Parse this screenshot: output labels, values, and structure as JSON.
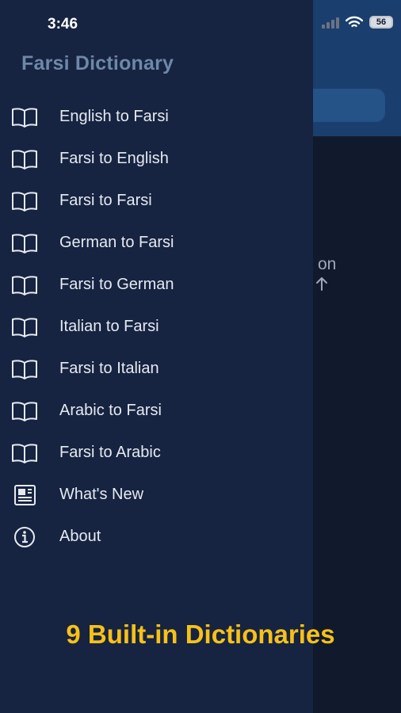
{
  "status_bar": {
    "time": "3:46",
    "battery": "56"
  },
  "background": {
    "hint_text": "on",
    "arrow_icon": "arrow-up-icon"
  },
  "drawer": {
    "title": "Farsi Dictionary",
    "items": [
      {
        "label": "English to Farsi",
        "icon": "book-icon"
      },
      {
        "label": "Farsi to English",
        "icon": "book-icon"
      },
      {
        "label": "Farsi to Farsi",
        "icon": "book-icon"
      },
      {
        "label": "German to Farsi",
        "icon": "book-icon"
      },
      {
        "label": "Farsi to German",
        "icon": "book-icon"
      },
      {
        "label": "Italian to Farsi",
        "icon": "book-icon"
      },
      {
        "label": "Farsi to Italian",
        "icon": "book-icon"
      },
      {
        "label": "Arabic to Farsi",
        "icon": "book-icon"
      },
      {
        "label": "Farsi to Arabic",
        "icon": "book-icon"
      },
      {
        "label": "What's New",
        "icon": "newspaper-icon"
      },
      {
        "label": "About",
        "icon": "info-icon"
      }
    ]
  },
  "promo": {
    "text": "9 Built-in Dictionaries"
  },
  "colors": {
    "drawer_bg": "#162341",
    "header_bg": "#1a3f6e",
    "title": "#6e88a8",
    "promo": "#f7c117"
  }
}
